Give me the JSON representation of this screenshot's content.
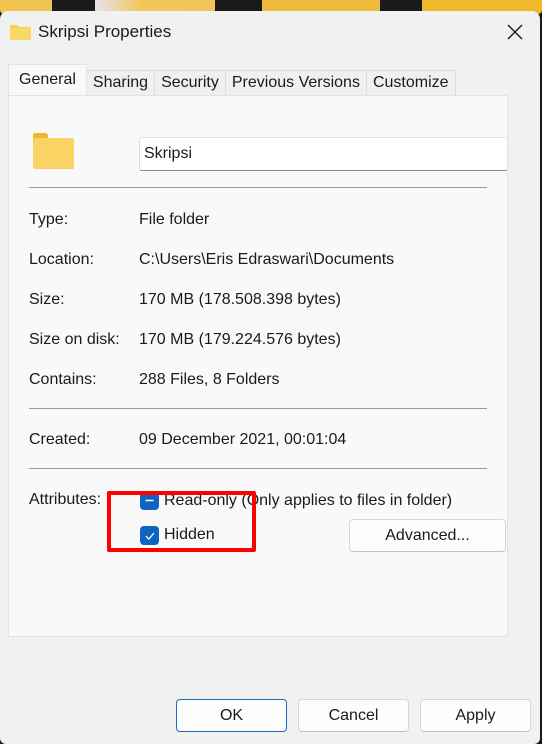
{
  "window": {
    "title": "Skripsi Properties",
    "title_icon": "folder-icon",
    "close_icon": "close-icon"
  },
  "tabs": [
    {
      "label": "General",
      "active": true
    },
    {
      "label": "Sharing",
      "active": false
    },
    {
      "label": "Security",
      "active": false
    },
    {
      "label": "Previous Versions",
      "active": false
    },
    {
      "label": "Customize",
      "active": false
    }
  ],
  "general": {
    "folder_name": "Skripsi",
    "rows": [
      {
        "label": "Type:",
        "value": "File folder"
      },
      {
        "label": "Location:",
        "value": "C:\\Users\\Eris Edraswari\\Documents"
      },
      {
        "label": "Size:",
        "value": "170 MB (178.508.398 bytes)"
      },
      {
        "label": "Size on disk:",
        "value": "170 MB (179.224.576 bytes)"
      },
      {
        "label": "Contains:",
        "value": "288 Files, 8 Folders"
      }
    ],
    "created": {
      "label": "Created:",
      "value": "09 December 2021, 00:01:04"
    },
    "attributes": {
      "label": "Attributes:",
      "read_only": {
        "label": "Read-only (Only applies to files in folder)",
        "state": "indeterminate"
      },
      "hidden": {
        "label": "Hidden",
        "state": "checked"
      },
      "advanced_button": "Advanced..."
    }
  },
  "footer": {
    "ok": "OK",
    "cancel": "Cancel",
    "apply": "Apply"
  },
  "colors": {
    "accent": "#0f63c1",
    "highlight_box": "#ff0000",
    "folder_yellow": "#f8d562"
  }
}
